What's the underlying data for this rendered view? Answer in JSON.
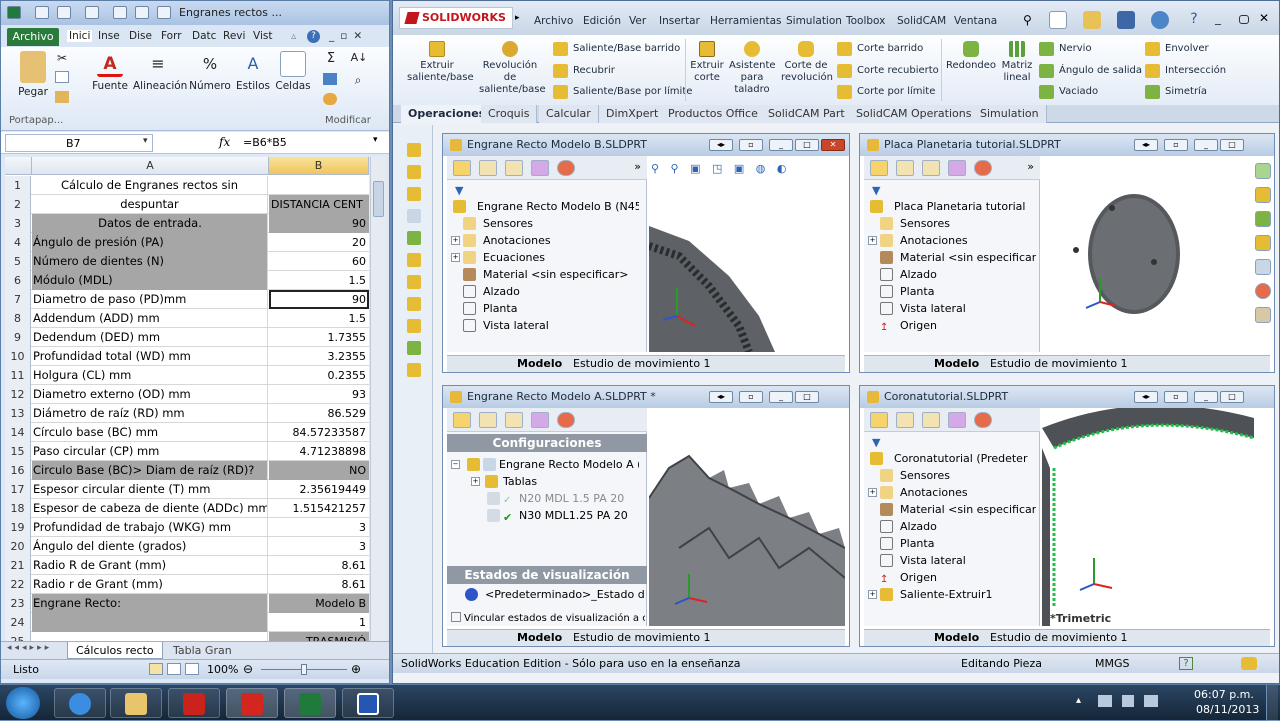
{
  "excel": {
    "title": "Engranes rectos ...",
    "file_tab": "Archivo",
    "ribbon_tabs": [
      "Inici",
      "Inse",
      "Dise",
      "Forr",
      "Datc",
      "Revi",
      "Vist"
    ],
    "groups": {
      "pegar": "Pegar",
      "fuente": "Fuente",
      "alineacion": "Alineación",
      "numero": "Número",
      "estilos": "Estilos",
      "celdas": "Celdas",
      "portapapeles": "Portapap...",
      "modificar": "Modificar"
    },
    "name_box": "B7",
    "formula": "=B6*B5",
    "col_a": "A",
    "col_b": "B",
    "rows": [
      {
        "n": "1",
        "a": "Cálculo de Engranes rectos sin",
        "b": ""
      },
      {
        "n": "2",
        "a": "despuntar",
        "b": "DISTANCIA CENT"
      },
      {
        "n": "3",
        "a": "Datos de entrada.",
        "b": "90"
      },
      {
        "n": "4",
        "a": "Ángulo de presión (PA)",
        "b": "20"
      },
      {
        "n": "5",
        "a": "Número de dientes  (N)",
        "b": "60"
      },
      {
        "n": "6",
        "a": "Módulo (MDL)",
        "b": "1.5"
      },
      {
        "n": "7",
        "a": "Diametro de paso  (PD)mm",
        "b": "90"
      },
      {
        "n": "8",
        "a": "Addendum (ADD) mm",
        "b": "1.5"
      },
      {
        "n": "9",
        "a": "Dedendum (DED) mm",
        "b": "1.7355"
      },
      {
        "n": "10",
        "a": "Profundidad total (WD) mm",
        "b": "3.2355"
      },
      {
        "n": "11",
        "a": "Holgura (CL) mm",
        "b": "0.2355"
      },
      {
        "n": "12",
        "a": "Diametro externo (OD) mm",
        "b": "93"
      },
      {
        "n": "13",
        "a": "Diámetro de raíz (RD) mm",
        "b": "86.529"
      },
      {
        "n": "14",
        "a": "Círculo base (BC) mm",
        "b": "84.57233587"
      },
      {
        "n": "15",
        "a": "Paso circular (CP) mm",
        "b": "4.71238898"
      },
      {
        "n": "16",
        "a": "Circulo Base (BC)> Diam de raíz (RD)?",
        "b": "NO"
      },
      {
        "n": "17",
        "a": "Espesor circular diente (T) mm",
        "b": "2.35619449"
      },
      {
        "n": "18",
        "a": "Espesor de cabeza de diente (ADDc) mm",
        "b": "1.515421257"
      },
      {
        "n": "19",
        "a": "Profundidad de trabajo (WKG) mm",
        "b": "3"
      },
      {
        "n": "20",
        "a": "Ángulo del diente (grados)",
        "b": "3"
      },
      {
        "n": "21",
        "a": "Radio R de Grant (mm)",
        "b": "8.61"
      },
      {
        "n": "22",
        "a": "Radio r de Grant (mm)",
        "b": "8.61"
      },
      {
        "n": "23",
        "a": "Engrane Recto:",
        "b": "Modelo B"
      },
      {
        "n": "24",
        "a": "",
        "b": "1"
      },
      {
        "n": "25",
        "a": "",
        "b": "TRASMISIÓ"
      }
    ],
    "sheet_tabs": [
      "Cálculos recto",
      "Tabla Gran"
    ],
    "status": "Listo",
    "zoom": "100%"
  },
  "sw": {
    "logo": "SOLIDWORKS",
    "menu": [
      "Archivo",
      "Edición",
      "Ver",
      "Insertar",
      "Herramientas",
      "Simulation",
      "Toolbox",
      "SolidCAM",
      "Ventana"
    ],
    "cmds": {
      "extruir": "Extruir saliente/base",
      "revolucion": "Revolución de saliente/base",
      "barrido": "Saliente/Base barrido",
      "recubrir": "Recubrir",
      "limite": "Saliente/Base por límite",
      "extruir_corte": "Extruir corte",
      "asistente": "Asistente para taladro",
      "corte_rev": "Corte de revolución",
      "corte_barrido": "Corte barrido",
      "corte_recubierto": "Corte recubierto",
      "corte_limite": "Corte por límite",
      "redondeo": "Redondeo",
      "matriz": "Matriz lineal",
      "nervio": "Nervio",
      "angulo": "Ángulo de salida",
      "vaciado": "Vaciado",
      "envolver": "Envolver",
      "interseccion": "Intersección",
      "simetria": "Simetría"
    },
    "tabs": [
      "Operaciones",
      "Croquis",
      "Calcular",
      "DimXpert",
      "Productos Office",
      "SolidCAM Part",
      "SolidCAM Operations",
      "Simulation"
    ],
    "status": {
      "left": "SolidWorks Education Edition - Sólo para uso en la enseñanza",
      "mode": "Editando Pieza",
      "units": "MMGS"
    },
    "docs": {
      "b": {
        "title": "Engrane Recto Modelo B.SLDPRT",
        "root": "Engrane Recto Modelo B  (N45",
        "items": [
          "Sensores",
          "Anotaciones",
          "Ecuaciones",
          "Material <sin especificar>",
          "Alzado",
          "Planta",
          "Vista lateral"
        ]
      },
      "p": {
        "title": "Placa Planetaria tutorial.SLDPRT",
        "root": "Placa Planetaria tutorial",
        "items": [
          "Sensores",
          "Anotaciones",
          "Material <sin especificar",
          "Alzado",
          "Planta",
          "Vista lateral",
          "Origen"
        ]
      },
      "a": {
        "title": "Engrane Recto Modelo A.SLDPRT *",
        "config_header": "Configuraciones",
        "root": "Engrane Recto Modelo A (",
        "items": [
          "Tablas",
          "N20 MDL 1.5 PA 20",
          "N30 MDL1.25 PA 20"
        ],
        "states_header": "Estados de visualización",
        "state": "<Predeterminado>_Estado de vi",
        "link": "Vincular estados de visualización a config"
      },
      "c": {
        "title": "Coronatutorial.SLDPRT",
        "root": "Coronatutorial  (Predeter",
        "items": [
          "Sensores",
          "Anotaciones",
          "Material <sin especificar",
          "Alzado",
          "Planta",
          "Vista lateral",
          "Origen",
          "Saliente-Extruir1"
        ],
        "gfx_label": "*Trimetric"
      }
    },
    "doc_tabs": {
      "modelo": "Modelo",
      "estudio": "Estudio de movimiento 1"
    }
  },
  "taskbar": {
    "time": "06:07 p.m.",
    "date": "08/11/2013"
  }
}
